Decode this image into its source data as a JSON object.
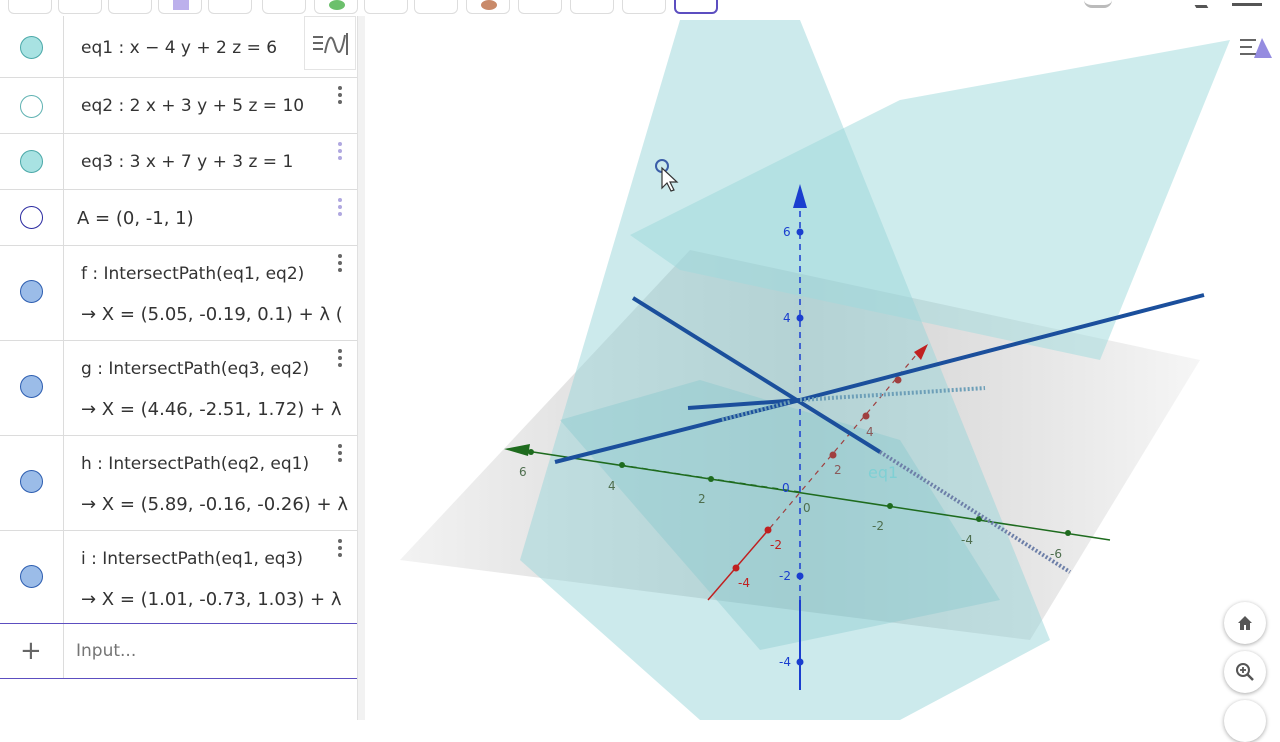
{
  "algebra": {
    "rows": [
      {
        "label": "eq1 :  x − 4 y + 2 z = 6",
        "marker_color": "#a8e2e2",
        "marker_fill": true
      },
      {
        "label": "eq2 :  2 x + 3 y + 5 z = 10",
        "marker_color": "#5fb2b2",
        "marker_fill": false
      },
      {
        "label": "eq3 :  3 x + 7 y + 3 z = 1",
        "marker_color": "#a8e2e2",
        "marker_fill": true
      },
      {
        "label": "A = (0, -1, 1)",
        "marker_color": "#2a2aa0",
        "marker_fill": false
      },
      {
        "label": "f : IntersectPath(eq1, eq2)",
        "sub": "→  X = (5.05, -0.19, 0.1) + λ (",
        "marker_color": "#9bbce8",
        "marker_fill": true
      },
      {
        "label": "g : IntersectPath(eq3, eq2)",
        "sub": "→  X = (4.46, -2.51, 1.72) + λ",
        "marker_color": "#9bbce8",
        "marker_fill": true
      },
      {
        "label": "h : IntersectPath(eq2, eq1)",
        "sub": "→  X = (5.89, -0.16, -0.26) + λ",
        "marker_color": "#9bbce8",
        "marker_fill": true
      },
      {
        "label": "i : IntersectPath(eq1, eq3)",
        "sub": "→  X = (1.01, -0.73, 1.03) + λ",
        "marker_color": "#9bbce8",
        "marker_fill": true
      }
    ],
    "input_placeholder": "Input...",
    "add_symbol": "+"
  },
  "view": {
    "plane_label": "eq1",
    "z_ticks": [
      "6",
      "4",
      "-2",
      "-4"
    ],
    "x_ticks": [
      "4",
      "2",
      "-2",
      "-4"
    ],
    "y_ticks": [
      "6",
      "4",
      "2",
      "-2",
      "-4",
      "-6"
    ],
    "origin_label": "0"
  },
  "colors": {
    "accent": "#5c4ec0",
    "plane": "#8fd3d6",
    "line": "#1b4f9c",
    "z_axis": "#1a3ecf",
    "y_axis": "#1e6b1e",
    "x_axis": "#c02020"
  },
  "icons": [
    "algebra-style-icon",
    "graphics-style-icon",
    "home-icon",
    "zoom-in-icon",
    "kebab-menu-icon",
    "add-icon"
  ]
}
